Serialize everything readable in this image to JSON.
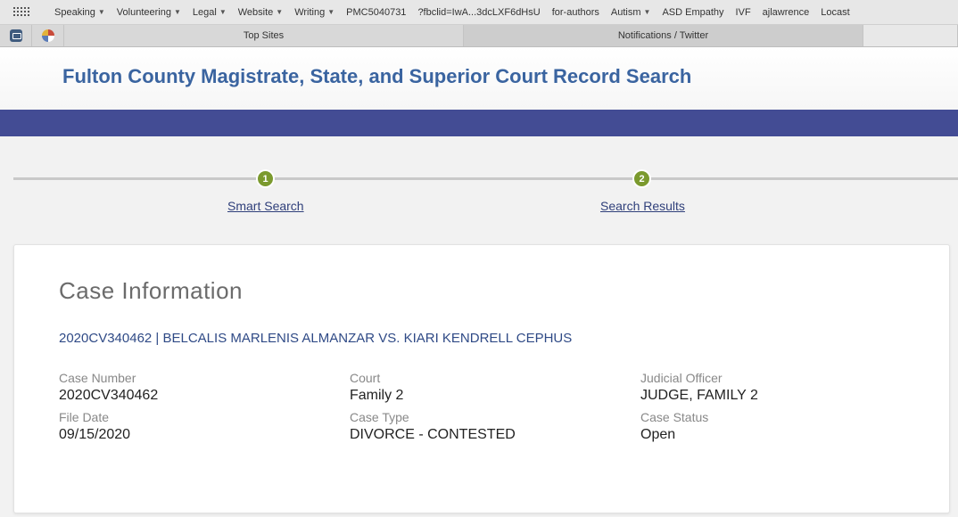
{
  "bookmarks": [
    {
      "label": "Speaking",
      "dropdown": true
    },
    {
      "label": "Volunteering",
      "dropdown": true
    },
    {
      "label": "Legal",
      "dropdown": true
    },
    {
      "label": "Website",
      "dropdown": true
    },
    {
      "label": "Writing",
      "dropdown": true
    },
    {
      "label": "PMC5040731",
      "dropdown": false
    },
    {
      "label": "?fbclid=IwA...3dcLXF6dHsU",
      "dropdown": false
    },
    {
      "label": "for-authors",
      "dropdown": false
    },
    {
      "label": "Autism",
      "dropdown": true
    },
    {
      "label": "ASD Empathy",
      "dropdown": false
    },
    {
      "label": "IVF",
      "dropdown": false
    },
    {
      "label": "ajlawrence",
      "dropdown": false
    },
    {
      "label": "Locast",
      "dropdown": false
    }
  ],
  "tabs": {
    "top_sites": "Top Sites",
    "notifications": "Notifications / Twitter"
  },
  "page": {
    "title": "Fulton County Magistrate, State, and Superior Court Record Search"
  },
  "steps": [
    {
      "number": "1",
      "label": "Smart Search"
    },
    {
      "number": "2",
      "label": "Search Results"
    }
  ],
  "case": {
    "section_title": "Case Information",
    "heading": "2020CV340462 | BELCALIS MARLENIS ALMANZAR VS. KIARI KENDRELL CEPHUS",
    "fields": {
      "case_number": {
        "label": "Case Number",
        "value": "2020CV340462"
      },
      "file_date": {
        "label": "File Date",
        "value": "09/15/2020"
      },
      "court": {
        "label": "Court",
        "value": "Family 2"
      },
      "case_type": {
        "label": "Case Type",
        "value": "DIVORCE - CONTESTED"
      },
      "judicial_officer": {
        "label": "Judicial Officer",
        "value": "JUDGE, FAMILY 2"
      },
      "case_status": {
        "label": "Case Status",
        "value": "Open"
      }
    }
  },
  "colors": {
    "title_blue": "#3a64a0",
    "band_blue": "#434c94",
    "step_green": "#7b9a2e",
    "link_navy": "#2f3f7a"
  }
}
